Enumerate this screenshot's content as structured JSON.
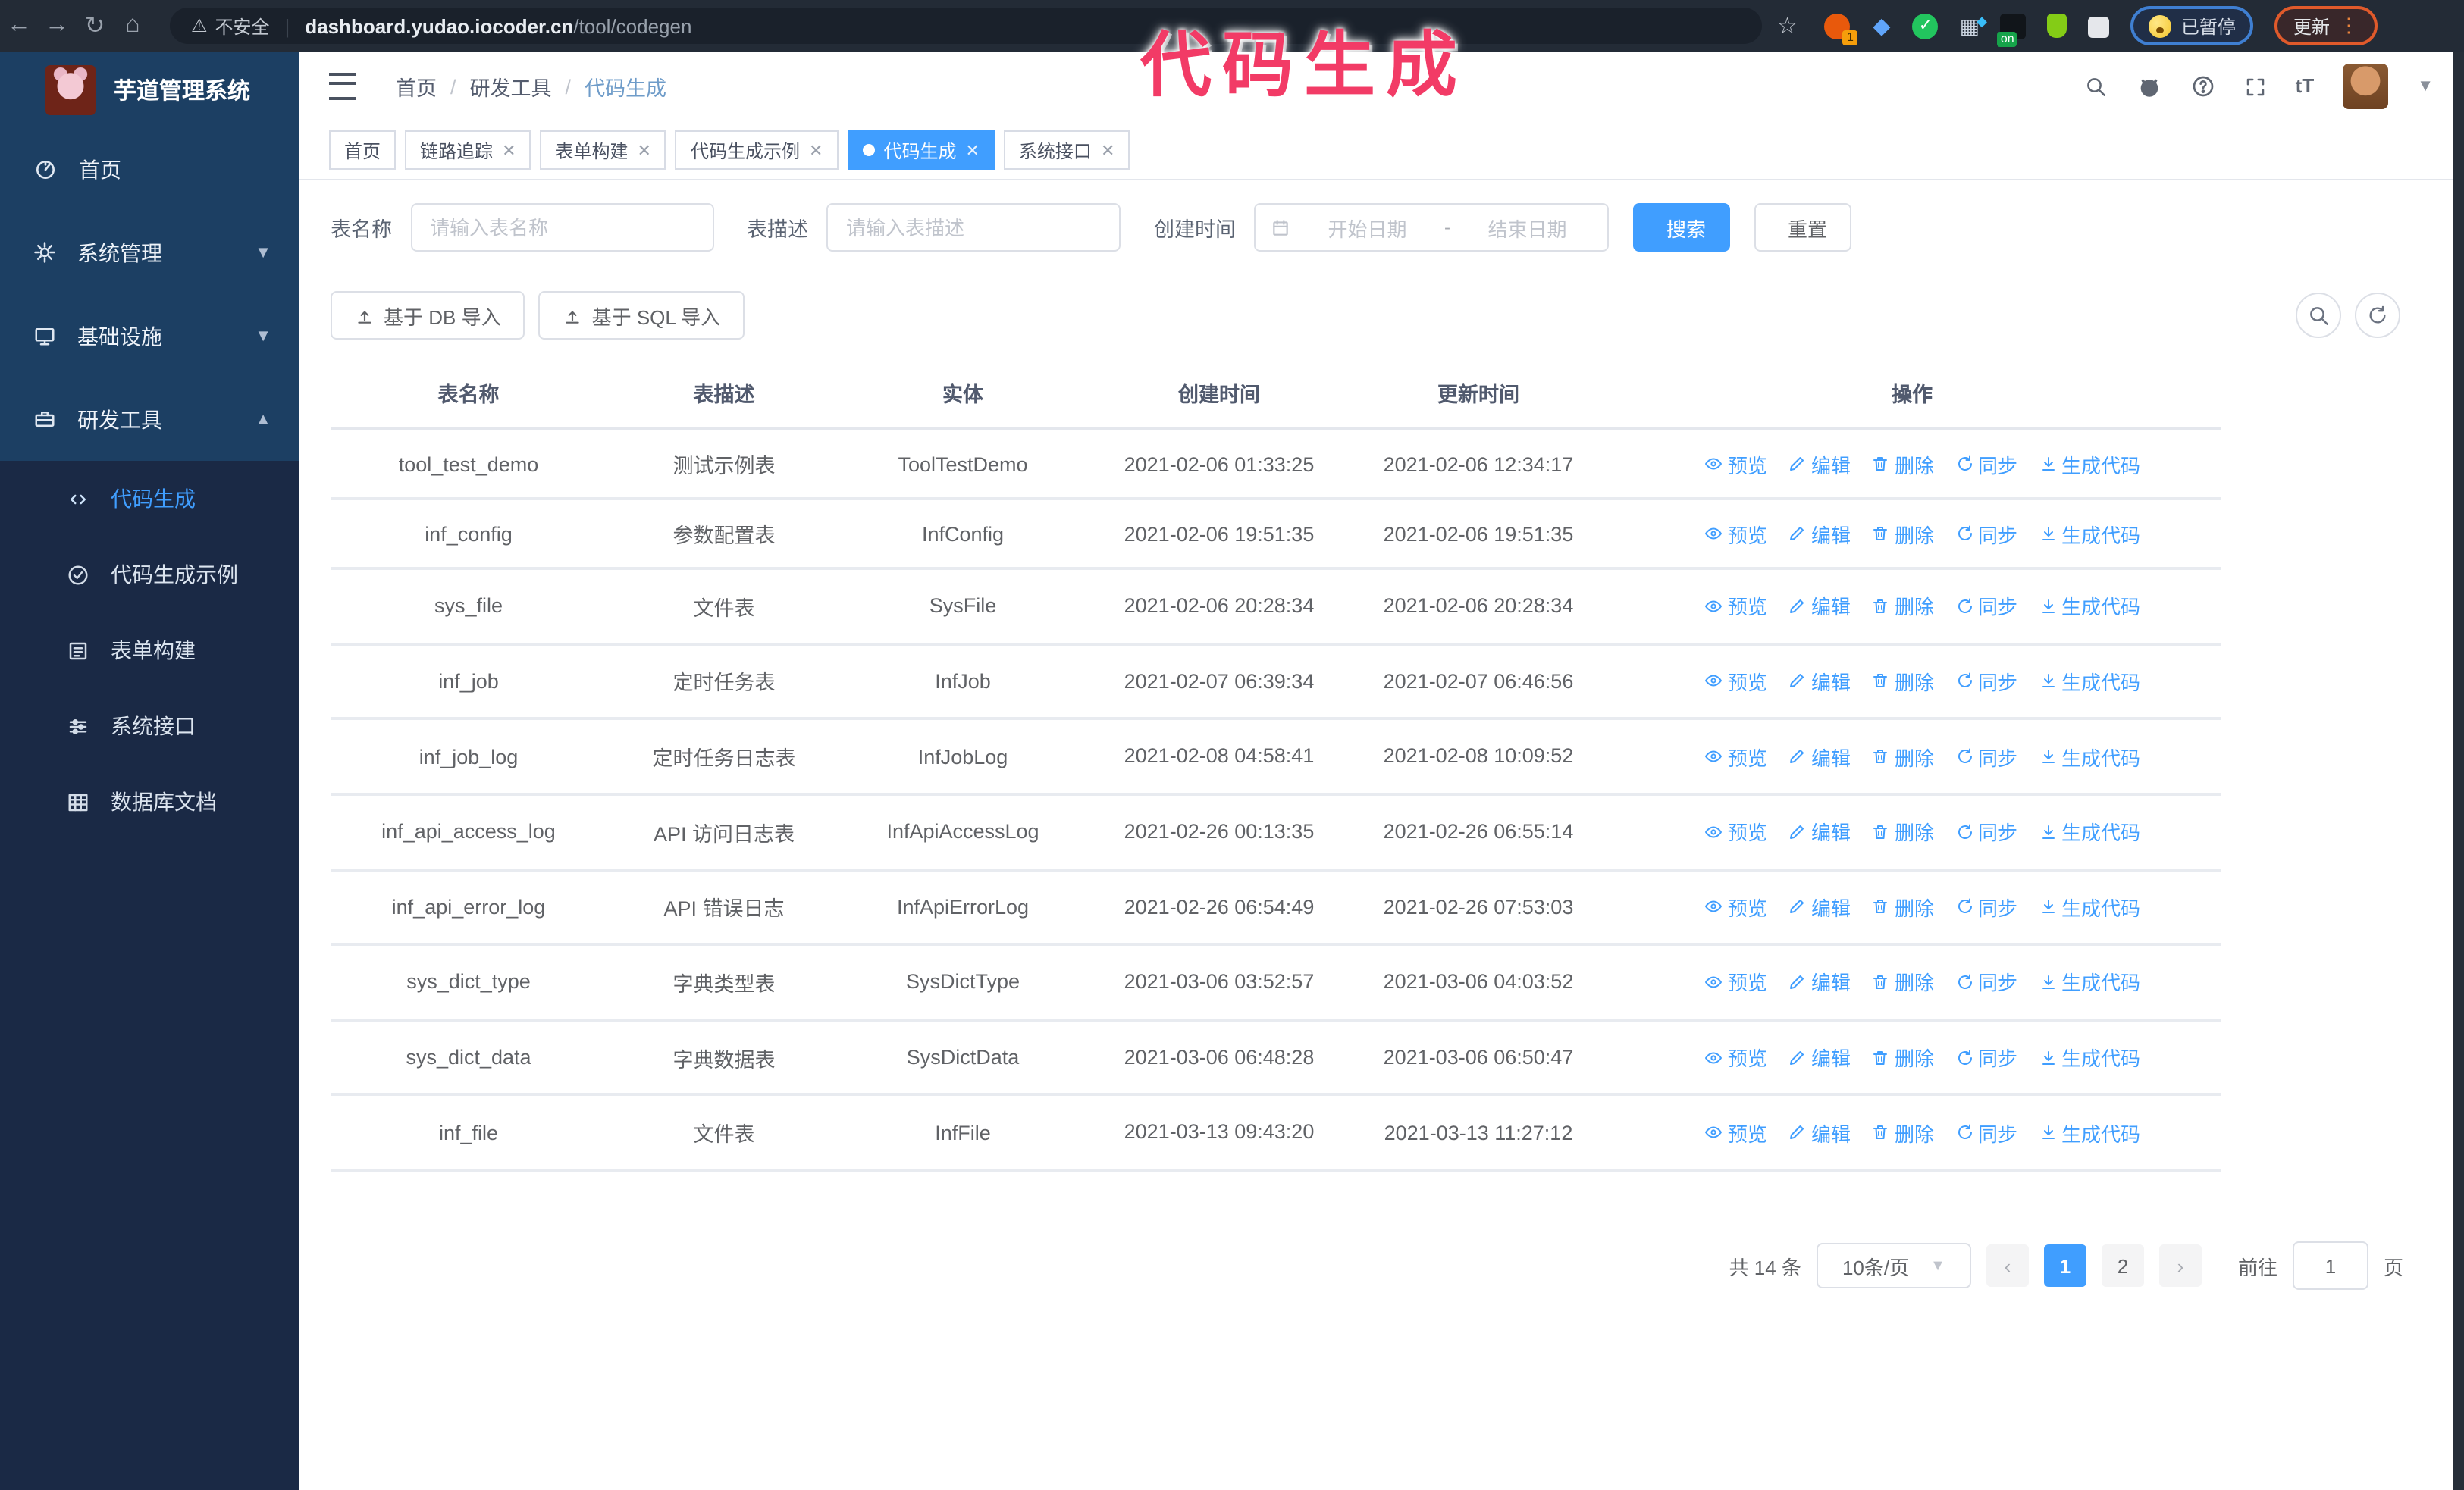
{
  "browser": {
    "security_warning": "不安全",
    "url_host": "dashboard.yudao.iocoder.cn",
    "url_path": "/tool/codegen",
    "extension_badge_1": "1",
    "extension_badge_on": "on",
    "paused_badge": "已暂停",
    "update_button": "更新",
    "update_dots": "⋮"
  },
  "annotation": {
    "text": "代码生成"
  },
  "sidebar": {
    "app_title": "芋道管理系统",
    "items": [
      {
        "label": "首页",
        "icon": "dashboard-icon",
        "chevron": ""
      },
      {
        "label": "系统管理",
        "icon": "gear-icon",
        "chevron": "down"
      },
      {
        "label": "基础设施",
        "icon": "monitor-icon",
        "chevron": "down"
      },
      {
        "label": "研发工具",
        "icon": "toolbox-icon",
        "chevron": "up"
      }
    ],
    "submenu": [
      {
        "label": "代码生成",
        "icon": "code-icon",
        "active": true
      },
      {
        "label": "代码生成示例",
        "icon": "example-icon",
        "active": false
      },
      {
        "label": "表单构建",
        "icon": "form-icon",
        "active": false
      },
      {
        "label": "系统接口",
        "icon": "api-icon",
        "active": false
      },
      {
        "label": "数据库文档",
        "icon": "database-icon",
        "active": false
      }
    ]
  },
  "header": {
    "breadcrumb": [
      "首页",
      "研发工具",
      "代码生成"
    ]
  },
  "tabs": [
    {
      "label": "首页",
      "closable": false,
      "active": false
    },
    {
      "label": "链路追踪",
      "closable": true,
      "active": false
    },
    {
      "label": "表单构建",
      "closable": true,
      "active": false
    },
    {
      "label": "代码生成示例",
      "closable": true,
      "active": false
    },
    {
      "label": "代码生成",
      "closable": true,
      "active": true
    },
    {
      "label": "系统接口",
      "closable": true,
      "active": false
    }
  ],
  "search_form": {
    "table_name_label": "表名称",
    "table_name_placeholder": "请输入表名称",
    "table_desc_label": "表描述",
    "table_desc_placeholder": "请输入表描述",
    "create_time_label": "创建时间",
    "date_start_placeholder": "开始日期",
    "date_separator": "-",
    "date_end_placeholder": "结束日期",
    "search_button": "搜索",
    "reset_button": "重置"
  },
  "toolbar": {
    "import_db_button": "基于 DB 导入",
    "import_sql_button": "基于 SQL 导入"
  },
  "table": {
    "columns": [
      "表名称",
      "表描述",
      "实体",
      "创建时间",
      "更新时间",
      "操作"
    ],
    "actions": [
      "预览",
      "编辑",
      "删除",
      "同步",
      "生成代码"
    ],
    "rows": [
      {
        "name": "tool_test_demo",
        "desc": "测试示例表",
        "entity": "ToolTestDemo",
        "created": "2021-02-06 01:33:25",
        "created_wrapped": false,
        "updated": "2021-02-06 12:34:17",
        "updated_wrapped": false
      },
      {
        "name": "inf_config",
        "desc": "参数配置表",
        "entity": "InfConfig",
        "created": "2021-02-06 19:51:35",
        "created_wrapped": false,
        "updated": "2021-02-06 19:51:35",
        "updated_wrapped": false
      },
      {
        "name": "sys_file",
        "desc": "文件表",
        "entity": "SysFile",
        "created": "2021-02-06 20:28:34",
        "created_wrapped": true,
        "updated": "2021-02-06 20:28:34",
        "updated_wrapped": true
      },
      {
        "name": "inf_job",
        "desc": "定时任务表",
        "entity": "InfJob",
        "created": "2021-02-07 06:39:34",
        "created_wrapped": true,
        "updated": "2021-02-07 06:46:56",
        "updated_wrapped": true
      },
      {
        "name": "inf_job_log",
        "desc": "定时任务日志表",
        "entity": "InfJobLog",
        "created": "2021-02-08 04:58:41",
        "created_wrapped": true,
        "updated": "2021-02-08 10:09:52",
        "updated_wrapped": true
      },
      {
        "name": "inf_api_access_log",
        "desc": "API 访问日志表",
        "entity": "InfApiAccessLog",
        "created": "2021-02-26 00:13:35",
        "created_wrapped": false,
        "updated": "2021-02-26 06:55:14",
        "updated_wrapped": true
      },
      {
        "name": "inf_api_error_log",
        "desc": "API 错误日志",
        "entity": "InfApiErrorLog",
        "created": "2021-02-26 06:54:49",
        "created_wrapped": true,
        "updated": "2021-02-26 07:53:03",
        "updated_wrapped": true
      },
      {
        "name": "sys_dict_type",
        "desc": "字典类型表",
        "entity": "SysDictType",
        "created": "2021-03-06 03:52:57",
        "created_wrapped": true,
        "updated": "2021-03-06 04:03:52",
        "updated_wrapped": true
      },
      {
        "name": "sys_dict_data",
        "desc": "字典数据表",
        "entity": "SysDictData",
        "created": "2021-03-06 06:48:28",
        "created_wrapped": true,
        "updated": "2021-03-06 06:50:47",
        "updated_wrapped": true
      },
      {
        "name": "inf_file",
        "desc": "文件表",
        "entity": "InfFile",
        "created": "2021-03-13 09:43:20",
        "created_wrapped": true,
        "updated": "2021-03-13 11:27:12",
        "updated_wrapped": false
      }
    ]
  },
  "pagination": {
    "total_text": "共 14 条",
    "page_size": "10条/页",
    "pages": [
      "1",
      "2"
    ],
    "active_page": "1",
    "goto_label": "前往",
    "goto_value": "1",
    "goto_suffix": "页"
  },
  "colors": {
    "accent": "#409eff",
    "annotation": "#f23b66",
    "sidebar": "#1c3f63",
    "sidebar_submenu": "#1a2945",
    "chrome": "#232b36"
  }
}
